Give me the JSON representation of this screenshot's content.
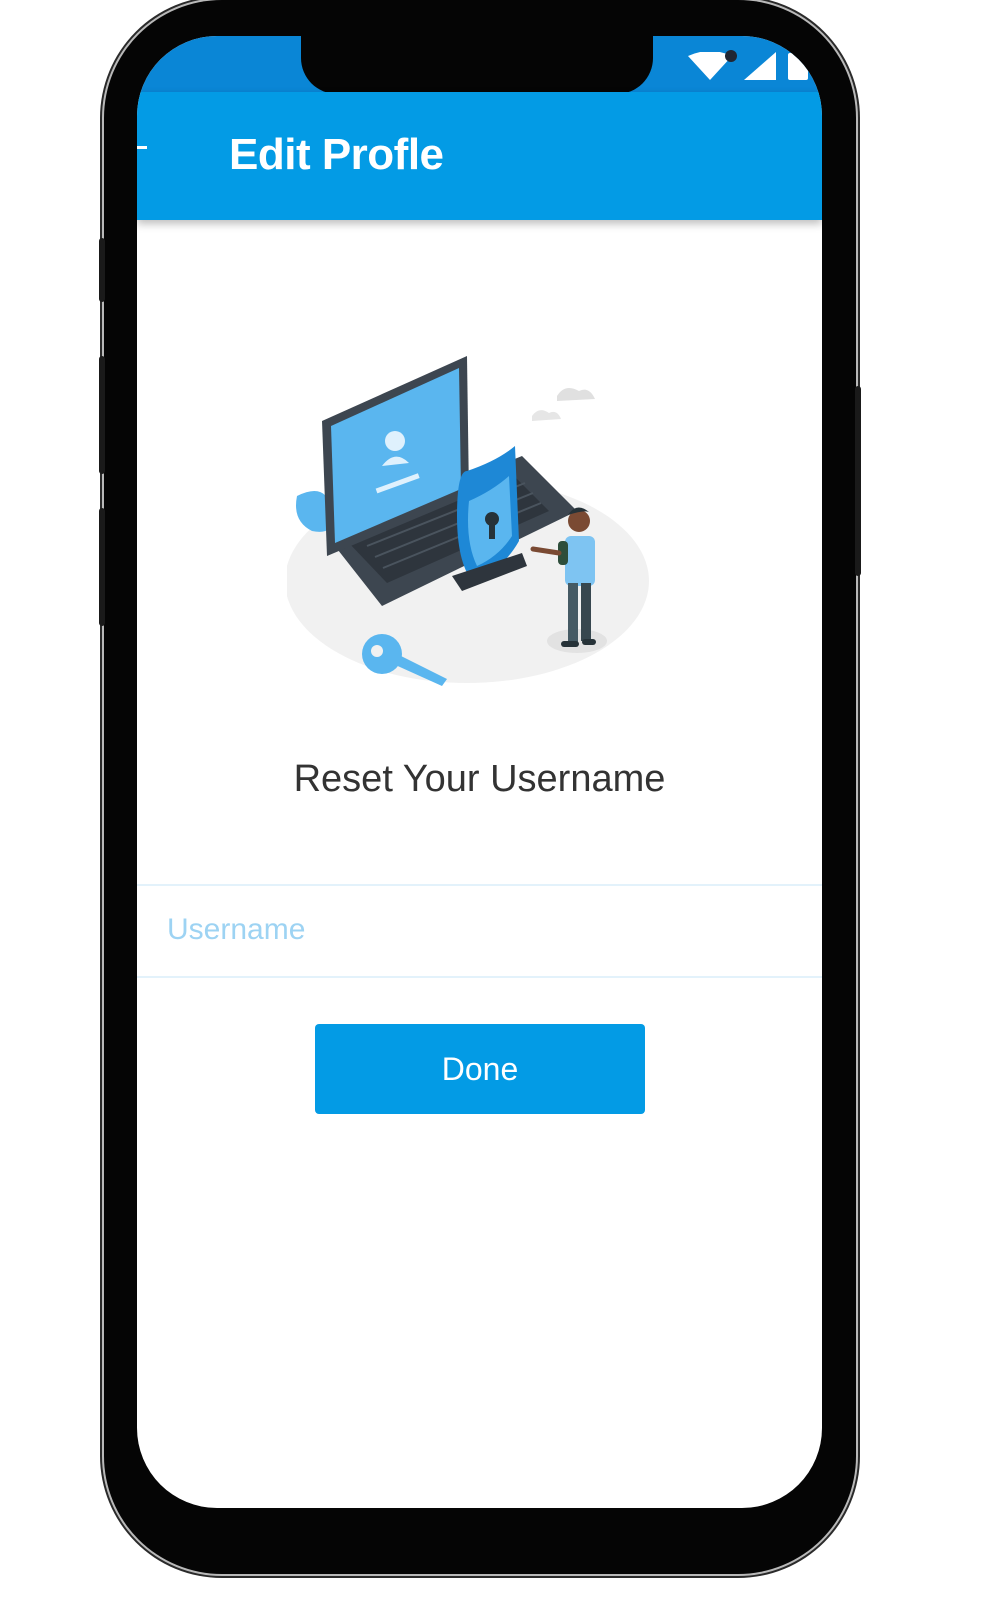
{
  "appbar": {
    "title": "Edit Profle",
    "back_icon": "back-arrow-icon"
  },
  "status_bar": {
    "icons": [
      "wifi-icon",
      "signal-icon",
      "battery-icon"
    ]
  },
  "main": {
    "heading": "Reset Your Username",
    "username_field": {
      "placeholder": "Username",
      "value": ""
    },
    "done_button": "Done"
  },
  "colors": {
    "primary": "#039be5",
    "status": "#0a86d6",
    "placeholder": "#9dd3f3",
    "heading": "#333333"
  }
}
